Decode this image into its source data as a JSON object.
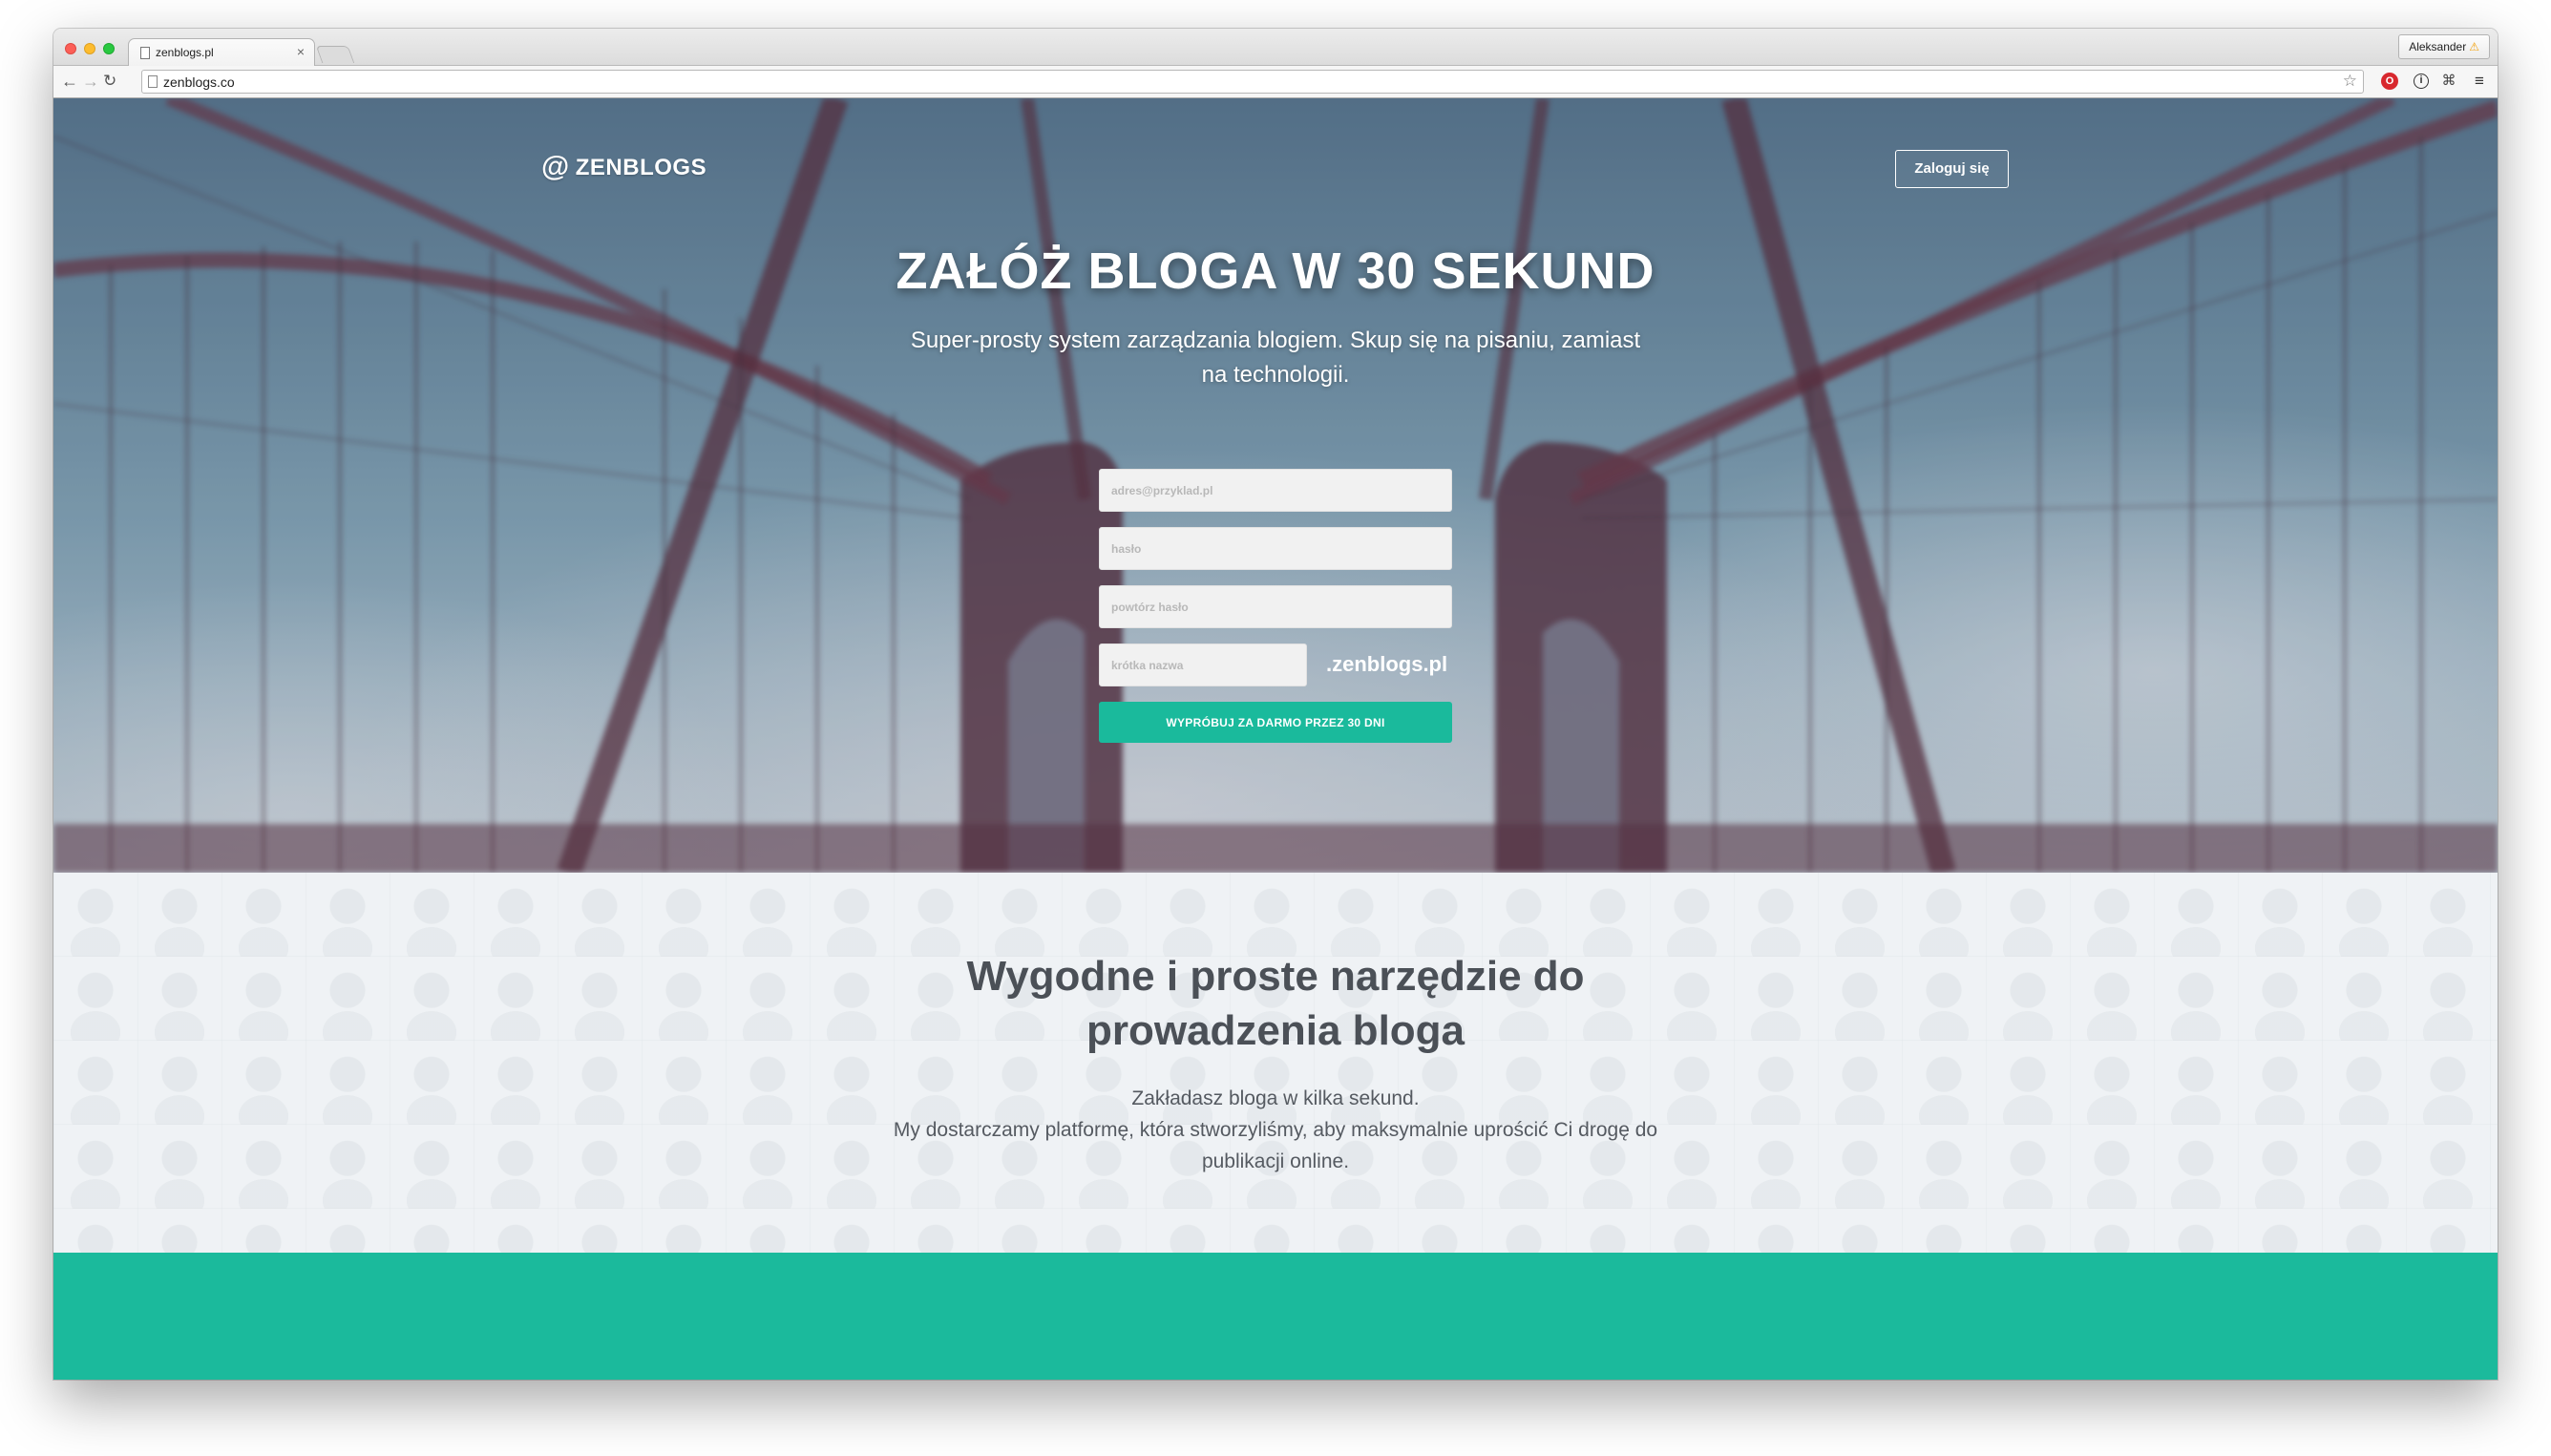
{
  "browser": {
    "tab_title": "zenblogs.pl",
    "tab_close": "×",
    "profile_name": "Aleksander",
    "profile_warning_icon": "⚠",
    "url": "zenblogs.co",
    "icons": {
      "back": "←",
      "forward": "→",
      "reload": "↻",
      "star": "☆",
      "opera": "O",
      "info": "i",
      "evernote": "⌘",
      "menu": "≡"
    }
  },
  "header": {
    "logo_icon": "@",
    "logo_text": "ZENBLOGS",
    "login_label": "Zaloguj się"
  },
  "hero": {
    "title": "ZAŁÓŻ BLOGA W 30 SEKUND",
    "subtitle": "Super-prosty system zarządzania blogiem. Skup się na pisaniu, zamiast na technologii."
  },
  "signup_form": {
    "email_placeholder": "adres@przyklad.pl",
    "password_placeholder": "hasło",
    "repeat_password_placeholder": "powtórz hasło",
    "short_name_placeholder": "krótka nazwa",
    "domain_suffix": ".zenblogs.pl",
    "submit_label": "WYPRÓBUJ ZA DARMO PRZEZ 30 DNI"
  },
  "features": {
    "title": "Wygodne i proste narzędzie do prowadzenia bloga",
    "line1": "Zakładasz bloga w kilka sekund.",
    "line2": "My dostarczamy platformę, która stworzyliśmy, aby maksymalnie uprościć Ci drogę do publikacji online."
  },
  "colors": {
    "accent": "#1aba9c"
  }
}
